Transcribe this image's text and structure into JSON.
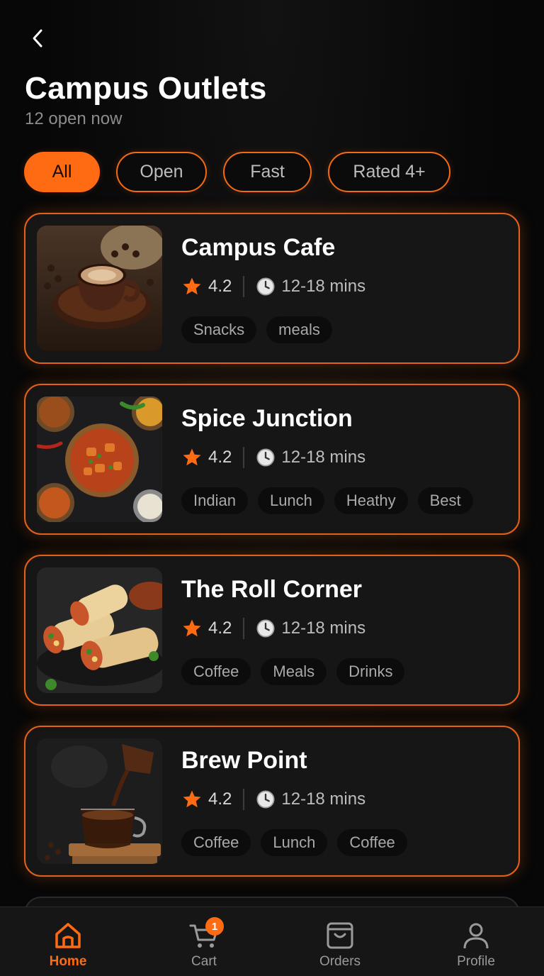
{
  "header": {
    "title": "Campus Outlets",
    "subtitle": "12 open now"
  },
  "filters": [
    "All",
    "Open",
    "Fast",
    "Rated 4+"
  ],
  "active_filter": "All",
  "outlets": [
    {
      "name": "Campus Cafe",
      "rating": "4.2",
      "time": "12-18 mins",
      "tags": [
        "Snacks",
        "meals"
      ],
      "image": "coffee-cup-image"
    },
    {
      "name": "Spice Junction",
      "rating": "4.2",
      "time": "12-18 mins",
      "tags": [
        "Indian",
        "Lunch",
        "Heathy",
        "Best"
      ],
      "image": "curry-bowls-image"
    },
    {
      "name": "The Roll Corner",
      "rating": "4.2",
      "time": "12-18 mins",
      "tags": [
        "Coffee",
        "Meals",
        "Drinks"
      ],
      "image": "wraps-image"
    },
    {
      "name": "Brew Point",
      "rating": "4.2",
      "time": "12-18 mins",
      "tags": [
        "Coffee",
        "Lunch",
        "Coffee"
      ],
      "image": "pour-coffee-image"
    }
  ],
  "tabbar": {
    "home": "Home",
    "cart": "Cart",
    "cart_badge": "1",
    "orders": "Orders",
    "profile": "Profile"
  },
  "icons": {
    "back": "chevron-left-icon",
    "star": "star-icon",
    "clock": "clock-icon",
    "home": "home-icon",
    "cart": "cart-icon",
    "orders": "bag-icon",
    "profile": "user-icon"
  },
  "colors": {
    "accent": "#ff6b12",
    "background": "#070707",
    "card": "#161616",
    "muted_text": "#8c8c8c"
  }
}
